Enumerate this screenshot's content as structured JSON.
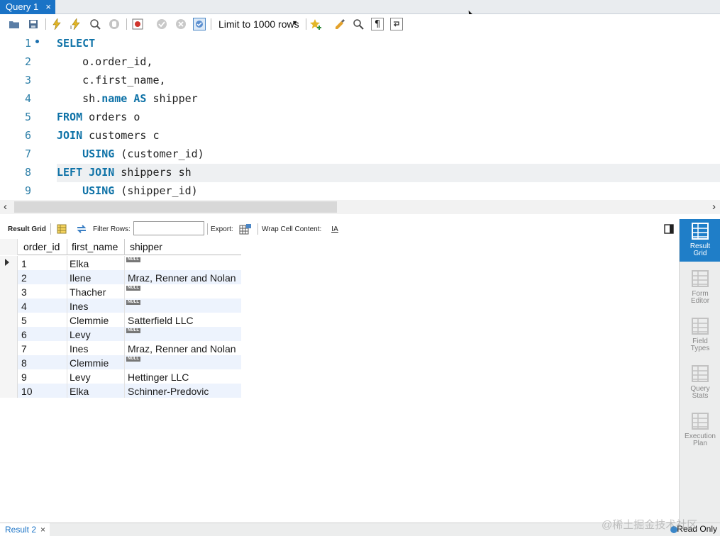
{
  "query_tab": {
    "label": "Query 1",
    "close": "×"
  },
  "toolbar": {
    "limit_label": "Limit to 1000 rows"
  },
  "editor": {
    "lines": [
      {
        "num": "1",
        "tokens": [
          {
            "t": "SELECT",
            "k": true
          }
        ]
      },
      {
        "num": "2",
        "tokens": [
          {
            "t": "    o.order_id,",
            "k": false
          }
        ]
      },
      {
        "num": "3",
        "tokens": [
          {
            "t": "    c.first_name,",
            "k": false
          }
        ]
      },
      {
        "num": "4",
        "tokens": [
          {
            "t": "    sh.",
            "k": false
          },
          {
            "t": "name",
            "k": true
          },
          {
            "t": " ",
            "k": false
          },
          {
            "t": "AS",
            "k": true
          },
          {
            "t": " shipper",
            "k": false
          }
        ]
      },
      {
        "num": "5",
        "tokens": [
          {
            "t": "FROM",
            "k": true
          },
          {
            "t": " orders o",
            "k": false
          }
        ]
      },
      {
        "num": "6",
        "tokens": [
          {
            "t": "JOIN",
            "k": true
          },
          {
            "t": " customers c",
            "k": false
          }
        ]
      },
      {
        "num": "7",
        "tokens": [
          {
            "t": "    ",
            "k": false
          },
          {
            "t": "USING",
            "k": true
          },
          {
            "t": " (customer_id)",
            "k": false
          }
        ]
      },
      {
        "num": "8",
        "tokens": [
          {
            "t": "LEFT JOIN",
            "k": true
          },
          {
            "t": " shippers sh",
            "k": false
          }
        ]
      },
      {
        "num": "9",
        "tokens": [
          {
            "t": "    ",
            "k": false
          },
          {
            "t": "USING",
            "k": true
          },
          {
            "t": " (shipper_id)",
            "k": false
          }
        ]
      }
    ]
  },
  "result_toolbar": {
    "result_grid": "Result Grid",
    "filter_rows": "Filter Rows:",
    "filter_value": "",
    "export": "Export:",
    "wrap": "Wrap Cell Content:"
  },
  "grid": {
    "columns": [
      "order_id",
      "first_name",
      "shipper"
    ],
    "null_label": "NULL",
    "rows": [
      {
        "order_id": "1",
        "first_name": "Elka",
        "shipper": null
      },
      {
        "order_id": "2",
        "first_name": "Ilene",
        "shipper": "Mraz, Renner and Nolan"
      },
      {
        "order_id": "3",
        "first_name": "Thacher",
        "shipper": null
      },
      {
        "order_id": "4",
        "first_name": "Ines",
        "shipper": null
      },
      {
        "order_id": "5",
        "first_name": "Clemmie",
        "shipper": "Satterfield LLC"
      },
      {
        "order_id": "6",
        "first_name": "Levy",
        "shipper": null
      },
      {
        "order_id": "7",
        "first_name": "Ines",
        "shipper": "Mraz, Renner and Nolan"
      },
      {
        "order_id": "8",
        "first_name": "Clemmie",
        "shipper": null
      },
      {
        "order_id": "9",
        "first_name": "Levy",
        "shipper": "Hettinger LLC"
      },
      {
        "order_id": "10",
        "first_name": "Elka",
        "shipper": "Schinner-Predovic"
      }
    ]
  },
  "right_panel": {
    "items": [
      {
        "line1": "Result",
        "line2": "Grid",
        "active": true
      },
      {
        "line1": "Form",
        "line2": "Editor",
        "active": false
      },
      {
        "line1": "Field",
        "line2": "Types",
        "active": false
      },
      {
        "line1": "Query",
        "line2": "Stats",
        "active": false
      },
      {
        "line1": "Execution",
        "line2": "Plan",
        "active": false
      }
    ]
  },
  "bottom": {
    "result_tab": "Result 2",
    "close": "×",
    "read_only": "Read Only",
    "watermark": "@稀土掘金技术社区"
  },
  "colors": {
    "accent": "#1a73c6",
    "keyword": "#0e72a7",
    "line_number": "#2d7fa8"
  }
}
